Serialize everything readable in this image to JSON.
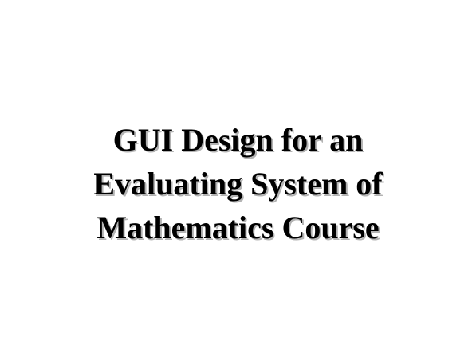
{
  "slide": {
    "title_lines": [
      "GUI Design for an",
      "Evaluating System of",
      "Mathematics Course"
    ]
  }
}
